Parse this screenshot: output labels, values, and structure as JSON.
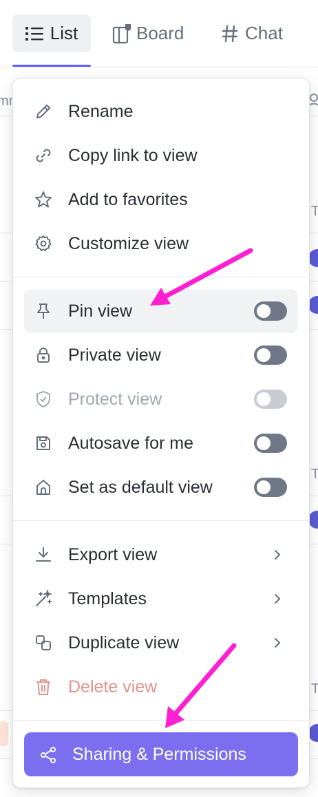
{
  "tabs": [
    {
      "label": "List",
      "icon": "list-icon",
      "active": true
    },
    {
      "label": "Board",
      "icon": "board-icon",
      "active": false
    },
    {
      "label": "Chat",
      "icon": "hash-icon",
      "active": false
    }
  ],
  "background": {
    "fragment_left": "mr",
    "fragment_right": "T"
  },
  "menu": {
    "group1": [
      {
        "label": "Rename",
        "icon": "pencil-icon"
      },
      {
        "label": "Copy link to view",
        "icon": "link-icon"
      },
      {
        "label": "Add to favorites",
        "icon": "star-icon"
      },
      {
        "label": "Customize view",
        "icon": "gear-icon"
      }
    ],
    "group2": [
      {
        "label": "Pin view",
        "icon": "pin-icon",
        "toggle": false,
        "highlighted": true
      },
      {
        "label": "Private view",
        "icon": "lock-icon",
        "toggle": false
      },
      {
        "label": "Protect view",
        "icon": "shield-icon",
        "toggle": false,
        "disabled": true
      },
      {
        "label": "Autosave for me",
        "icon": "save-icon",
        "toggle": false
      },
      {
        "label": "Set as default view",
        "icon": "home-icon",
        "toggle": false
      }
    ],
    "group3": [
      {
        "label": "Export view",
        "icon": "download-icon",
        "submenu": true
      },
      {
        "label": "Templates",
        "icon": "magic-wand-icon",
        "submenu": true
      },
      {
        "label": "Duplicate view",
        "icon": "duplicate-icon",
        "submenu": true
      },
      {
        "label": "Delete view",
        "icon": "trash-icon",
        "danger": true
      }
    ],
    "share_button": {
      "label": "Sharing & Permissions",
      "icon": "share-icon"
    }
  },
  "colors": {
    "accent": "#5d5fef",
    "share_button_bg": "#7b6ff0",
    "annotation_arrow": "#ff1fd2",
    "danger_text": "#e3938f",
    "toggle_off": "#707786"
  }
}
